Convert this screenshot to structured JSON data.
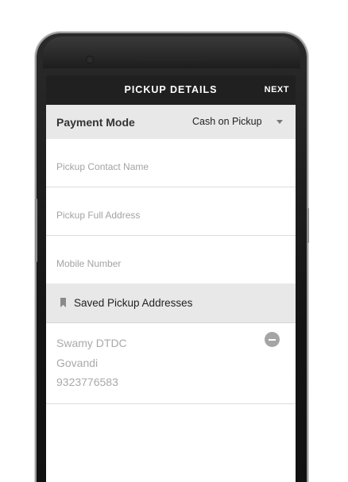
{
  "app_bar": {
    "title": "PICKUP DETAILS",
    "next_label": "NEXT"
  },
  "payment": {
    "label": "Payment Mode",
    "selected": "Cash on Pickup"
  },
  "fields": {
    "contact_name": {
      "placeholder": "Pickup Contact Name",
      "value": ""
    },
    "full_address": {
      "placeholder": "Pickup Full Address",
      "value": ""
    },
    "mobile": {
      "placeholder": "Mobile Number",
      "value": ""
    }
  },
  "saved": {
    "header_label": "Saved Pickup Addresses",
    "header_icon": "bookmark-icon",
    "addresses": [
      {
        "name": "Swamy DTDC",
        "area": "Govandi",
        "phone": "9323776583",
        "remove_icon": "minus-circle-icon"
      }
    ]
  },
  "colors": {
    "app_bar": "#202020",
    "section_bg": "#e8e8e8",
    "muted_text": "#a9a9a9"
  }
}
